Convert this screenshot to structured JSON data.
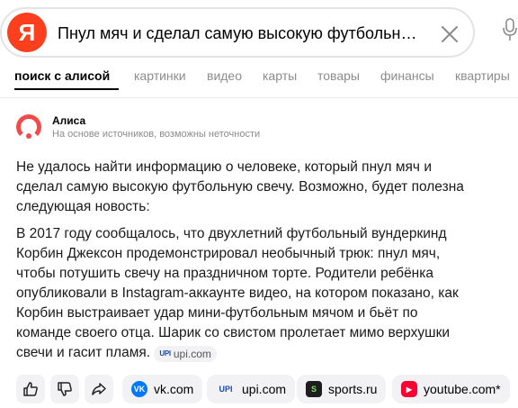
{
  "search": {
    "logo_letter": "Я",
    "query": "Пнул мяч и сделал самую высокую футбольн…"
  },
  "tabs": [
    {
      "label": "поиск с алисой",
      "active": true
    },
    {
      "label": "картинки"
    },
    {
      "label": "видео"
    },
    {
      "label": "карты"
    },
    {
      "label": "товары"
    },
    {
      "label": "финансы"
    },
    {
      "label": "квартиры"
    }
  ],
  "alice": {
    "name": "Алиса",
    "note": "На основе источников, возможны неточности",
    "paragraph1": "Не удалось найти информацию о человеке, который пнул мяч и сделал самую высокую футбольную свечу. Возможно, будет полезна следующая новость:",
    "paragraph2": "В 2017 году сообщалось, что двухлетний футбольный вундеркинд Корбин Джексон продемонстрировал необычный трюк: пнул мяч, чтобы потушить свечу на праздничном торте. Родители ребёнка опубликовали в Instagram-аккаунте видео, на котором показано, как Корбин выстраивает удар мини-футбольным мячом и бьёт по команде своего отца. Шарик со свистом пролетает мимо верхушки свечи и гасит пламя.",
    "inline_source": "upi.com",
    "inline_source_icon": "UPI"
  },
  "sources": [
    {
      "label": "vk.com",
      "icon": "vk-icon",
      "icon_text": "VK",
      "color": "#0077ff"
    },
    {
      "label": "upi.com",
      "icon": "upi-icon",
      "icon_text": "UPI",
      "color": "#1a4aa8"
    },
    {
      "label": "sports.ru",
      "icon": "sports-ru-icon",
      "icon_text": "S",
      "color": "#1d1d1d"
    },
    {
      "label": "youtube.com*",
      "icon": "youtube-icon",
      "icon_text": "▶",
      "color": "#ff0033"
    }
  ],
  "colors": {
    "brand": "#fc3f1d",
    "alice": "#f44a4a",
    "muted_text": "#8c8c8c",
    "chip_bg": "#f2f2f5"
  }
}
